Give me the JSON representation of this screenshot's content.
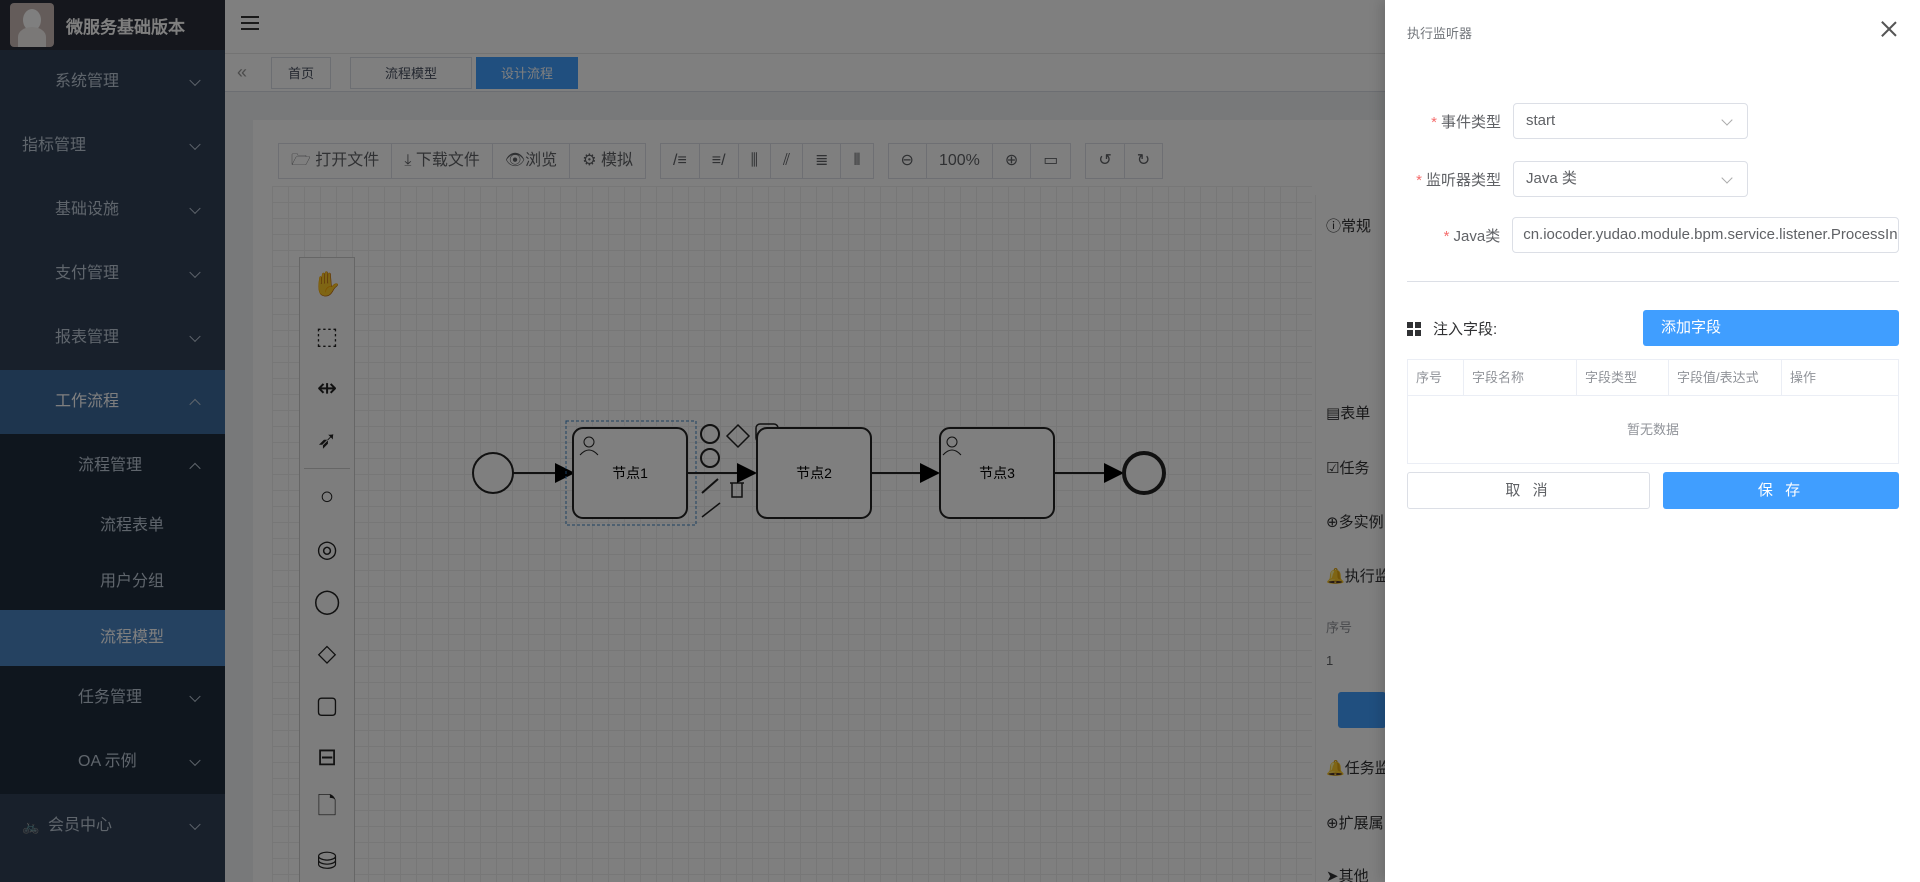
{
  "app": {
    "title": "微服务基础版本"
  },
  "sidebar": {
    "items": [
      {
        "label": "系统管理"
      },
      {
        "label": "指标管理"
      },
      {
        "label": "基础设施"
      },
      {
        "label": "支付管理"
      },
      {
        "label": "报表管理"
      },
      {
        "label": "工作流程"
      },
      {
        "label": "流程管理"
      },
      {
        "label": "流程表单"
      },
      {
        "label": "用户分组"
      },
      {
        "label": "流程模型"
      },
      {
        "label": "任务管理"
      },
      {
        "label": "OA 示例"
      },
      {
        "label": "会员中心"
      }
    ]
  },
  "tags": [
    {
      "label": "首页"
    },
    {
      "label": "流程模型"
    },
    {
      "label": "设计流程"
    }
  ],
  "toolbar": {
    "open_file": "打开文件",
    "download_file": "下载文件",
    "preview": "浏览",
    "simulate": "模拟",
    "zoom": "100%"
  },
  "diagram": {
    "nodes": [
      "节点1",
      "节点2",
      "节点3"
    ]
  },
  "props_panel": {
    "sections": [
      "常规",
      "表单",
      "任务",
      "多实例",
      "执行监",
      "任务监",
      "扩展属",
      "其他"
    ],
    "table_header": "序号",
    "table_value": "1"
  },
  "drawer": {
    "title": "执行监听器",
    "event_type_label": "事件类型",
    "event_type_value": "start",
    "listener_type_label": "监听器类型",
    "listener_type_value": "Java 类",
    "java_class_label": "Java类",
    "java_class_value": "cn.iocoder.yudao.module.bpm.service.listener.ProcessInstanceCopyListener",
    "inject_label": "注入字段:",
    "add_field": "添加字段",
    "columns": [
      "序号",
      "字段名称",
      "字段类型",
      "字段值/表达式",
      "操作"
    ],
    "empty_text": "暂无数据",
    "cancel": "取 消",
    "save": "保 存"
  }
}
